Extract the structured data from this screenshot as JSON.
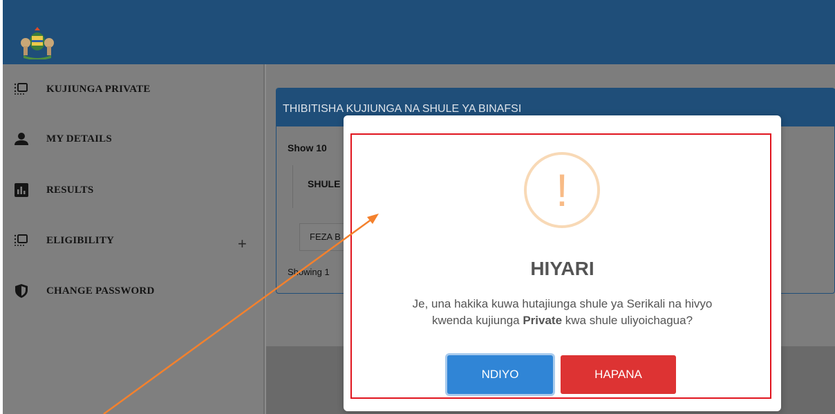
{
  "sidebar": {
    "items": [
      {
        "label": "KUJIUNGA PRIVATE",
        "icon": "list-screen-icon"
      },
      {
        "label": "MY DETAILS",
        "icon": "person-icon"
      },
      {
        "label": "RESULTS",
        "icon": "bar-chart-icon"
      },
      {
        "label": "ELIGIBILITY",
        "icon": "list-screen-icon"
      },
      {
        "label": "CHANGE PASSWORD",
        "icon": "shield-icon"
      }
    ],
    "expand_symbol": "+"
  },
  "card": {
    "title": "THIBITISHA KUJIUNGA NA SHULE YA BINAFSI",
    "show_label": "Show 10",
    "table_header": "SHULE",
    "table_row": "FEZA B",
    "showing_label": "Showing 1"
  },
  "modal": {
    "icon_symbol": "!",
    "title": "HIYARI",
    "text_line1": "Je, una hakika kuwa hutajiunga shule ya Serikali na hivyo",
    "text_line2_pre": "kwenda kujiunga ",
    "text_line2_bold": "Private",
    "text_line2_post": " kwa shule uliyoichagua?",
    "confirm_label": "NDIYO",
    "cancel_label": "HAPANA"
  },
  "colors": {
    "header": "#1f4e79",
    "confirm": "#3085d6",
    "cancel": "#dd3333",
    "warning": "#f8bb86",
    "highlight": "#e0141e",
    "arrow": "#f4812d"
  }
}
